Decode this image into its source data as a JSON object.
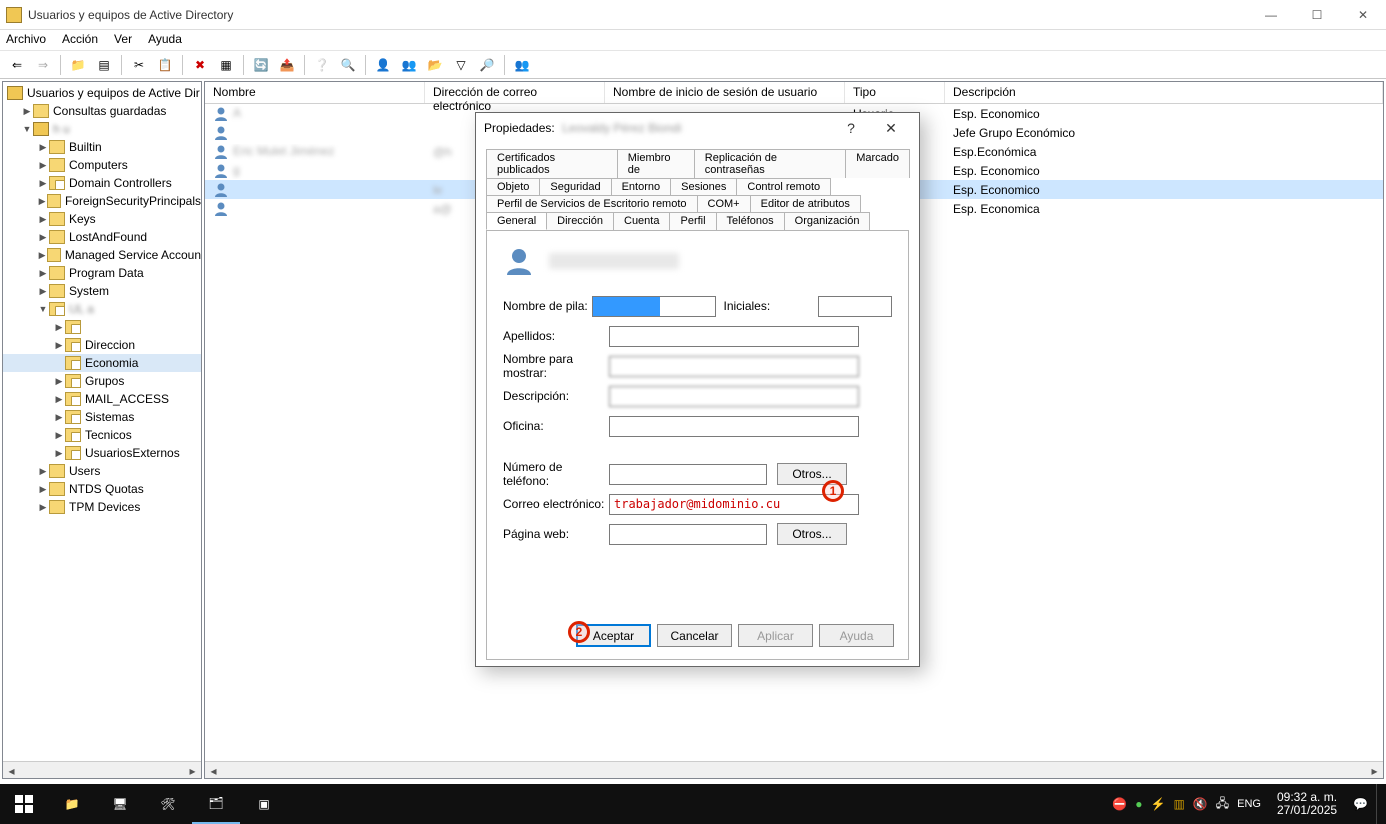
{
  "window": {
    "title": "Usuarios y equipos de Active Directory"
  },
  "menubar": [
    "Archivo",
    "Acción",
    "Ver",
    "Ayuda"
  ],
  "tree": {
    "root": "Usuarios y equipos de Active Dir",
    "nodes": [
      {
        "label": "Consultas guardadas",
        "icon": "folder",
        "indent": 1,
        "twist": "▶"
      },
      {
        "label": "h",
        "icon": "domain",
        "indent": 1,
        "twist": "▼",
        "blur": true,
        "extra": "u"
      },
      {
        "label": "Builtin",
        "icon": "folder",
        "indent": 2,
        "twist": "▶"
      },
      {
        "label": "Computers",
        "icon": "folder",
        "indent": 2,
        "twist": "▶"
      },
      {
        "label": "Domain Controllers",
        "icon": "ou",
        "indent": 2,
        "twist": "▶"
      },
      {
        "label": "ForeignSecurityPrincipals",
        "icon": "folder",
        "indent": 2,
        "twist": "▶"
      },
      {
        "label": "Keys",
        "icon": "folder",
        "indent": 2,
        "twist": "▶"
      },
      {
        "label": "LostAndFound",
        "icon": "folder",
        "indent": 2,
        "twist": "▶"
      },
      {
        "label": "Managed Service Accoun",
        "icon": "folder",
        "indent": 2,
        "twist": "▶"
      },
      {
        "label": "Program Data",
        "icon": "folder",
        "indent": 2,
        "twist": "▶"
      },
      {
        "label": "System",
        "icon": "folder",
        "indent": 2,
        "twist": "▶"
      },
      {
        "label": "UL",
        "icon": "ou",
        "indent": 2,
        "twist": "▼",
        "blur": true,
        "extra": "a"
      },
      {
        "label": "",
        "icon": "ou",
        "indent": 3,
        "twist": "▶",
        "blur": true
      },
      {
        "label": "Direccion",
        "icon": "ou",
        "indent": 3,
        "twist": "▶"
      },
      {
        "label": "Economia",
        "icon": "ou",
        "indent": 3,
        "twist": "",
        "sel": true
      },
      {
        "label": "Grupos",
        "icon": "ou",
        "indent": 3,
        "twist": "▶"
      },
      {
        "label": "MAIL_ACCESS",
        "icon": "ou",
        "indent": 3,
        "twist": "▶"
      },
      {
        "label": "Sistemas",
        "icon": "ou",
        "indent": 3,
        "twist": "▶"
      },
      {
        "label": "Tecnicos",
        "icon": "ou",
        "indent": 3,
        "twist": "▶"
      },
      {
        "label": "UsuariosExternos",
        "icon": "ou",
        "indent": 3,
        "twist": "▶"
      },
      {
        "label": "Users",
        "icon": "folder",
        "indent": 2,
        "twist": "▶"
      },
      {
        "label": "NTDS Quotas",
        "icon": "folder",
        "indent": 2,
        "twist": "▶"
      },
      {
        "label": "TPM Devices",
        "icon": "folder",
        "indent": 2,
        "twist": "▶"
      }
    ]
  },
  "list": {
    "columns": {
      "name": "Nombre",
      "email": "Dirección de correo electrónico",
      "logon": "Nombre de inicio de sesión de usuario",
      "type": "Tipo",
      "desc": "Descripción"
    },
    "rows": [
      {
        "name": "A",
        "email": "",
        "type": "Usuario",
        "desc": "Esp. Economico"
      },
      {
        "name": "",
        "email": "",
        "type": "",
        "desc": "Jefe Grupo Económico"
      },
      {
        "name": "Eric Mulet Jiménez",
        "email": "@h",
        "type": "",
        "desc": "Esp.Económica"
      },
      {
        "name": "g",
        "email": "",
        "type": "",
        "desc": "Esp. Economico"
      },
      {
        "name": "",
        "email": "le",
        "type": "",
        "desc": "Esp. Economico",
        "sel": true
      },
      {
        "name": "",
        "email": "a@",
        "type": "",
        "desc": "Esp. Economica"
      }
    ]
  },
  "dialog": {
    "title_prefix": "Propiedades:",
    "title_name": "Leovaldy Pérez Biondi",
    "tabs_row1": [
      "Certificados publicados",
      "Miembro de",
      "Replicación de contraseñas",
      "Marcado"
    ],
    "tabs_row2": [
      "Objeto",
      "Seguridad",
      "Entorno",
      "Sesiones",
      "Control remoto"
    ],
    "tabs_row3": [
      "Perfil de Servicios de Escritorio remoto",
      "COM+",
      "Editor de atributos"
    ],
    "tabs_row4": [
      "General",
      "Dirección",
      "Cuenta",
      "Perfil",
      "Teléfonos",
      "Organización"
    ],
    "active_tab": "General",
    "header_name": "",
    "labels": {
      "given": "Nombre de pila:",
      "initials": "Iniciales:",
      "surname": "Apellidos:",
      "display": "Nombre para mostrar:",
      "desc": "Descripción:",
      "office": "Oficina:",
      "phone": "Número de teléfono:",
      "email": "Correo electrónico:",
      "web": "Página web:",
      "otros": "Otros..."
    },
    "values": {
      "given": "",
      "initials": "",
      "surname": "",
      "display": "",
      "desc": "",
      "office": "",
      "phone": "",
      "email": "trabajador@midominio.cu",
      "web": ""
    },
    "buttons": {
      "ok": "Aceptar",
      "cancel": "Cancelar",
      "apply": "Aplicar",
      "help": "Ayuda"
    }
  },
  "annotations": {
    "a1": "1",
    "a2": "2"
  },
  "taskbar": {
    "lang": "ENG",
    "time": "09:32 a. m.",
    "date": "27/01/2025"
  }
}
